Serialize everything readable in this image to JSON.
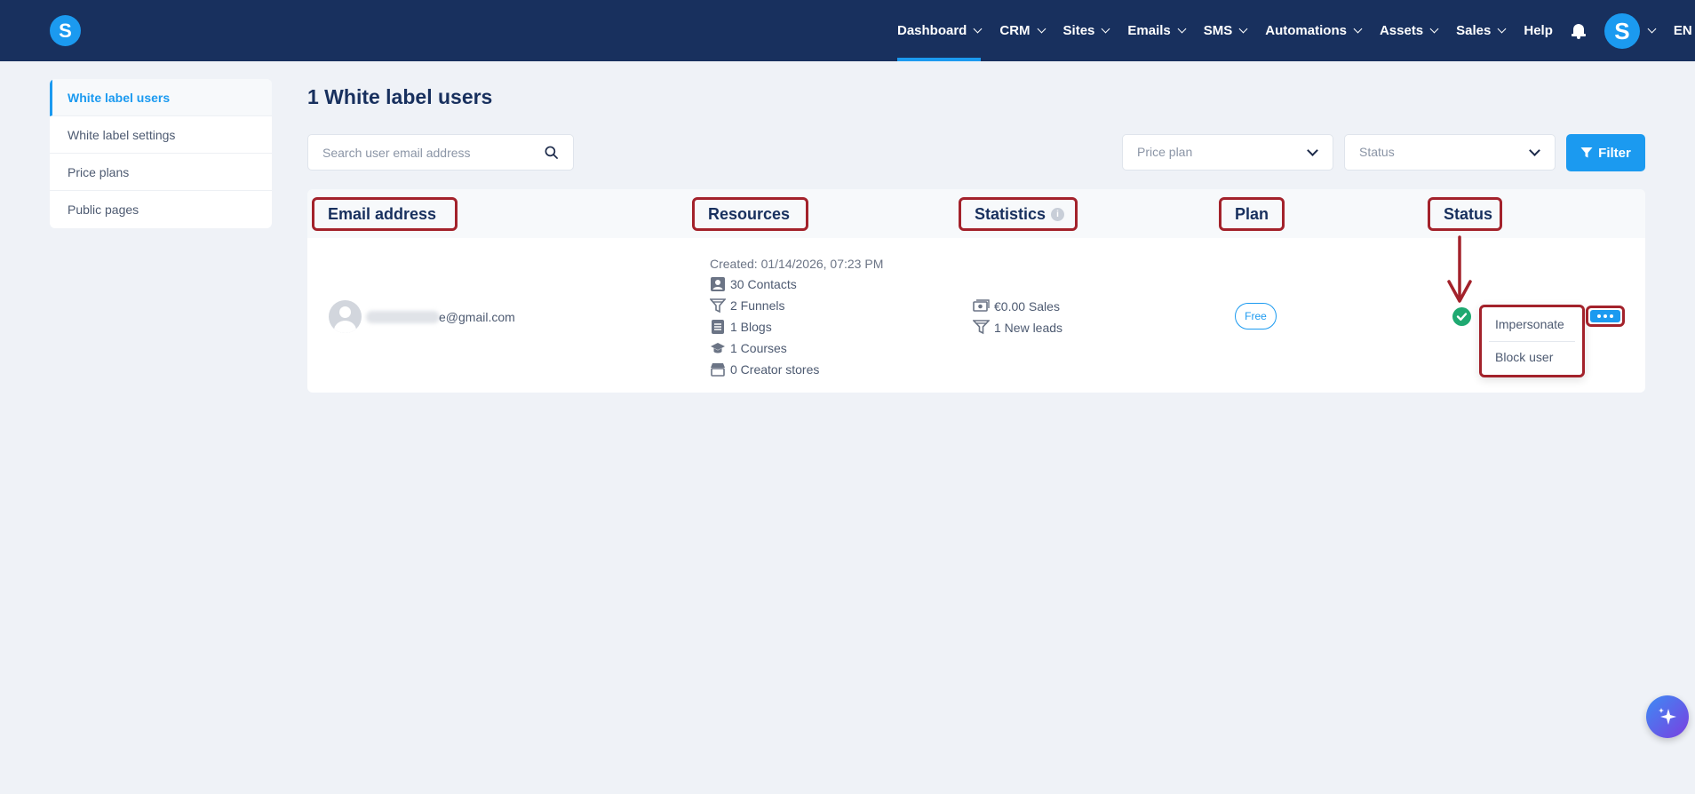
{
  "brand": {
    "logo_letter": "S"
  },
  "nav": {
    "items": [
      {
        "label": "Dashboard"
      },
      {
        "label": "CRM"
      },
      {
        "label": "Sites"
      },
      {
        "label": "Emails"
      },
      {
        "label": "SMS"
      },
      {
        "label": "Automations"
      },
      {
        "label": "Assets"
      },
      {
        "label": "Sales"
      },
      {
        "label": "Help"
      }
    ],
    "active": "Dashboard",
    "avatar_letter": "S",
    "language": "EN"
  },
  "sidebar": {
    "items": [
      {
        "label": "White label users",
        "active": true
      },
      {
        "label": "White label settings"
      },
      {
        "label": "Price plans"
      },
      {
        "label": "Public pages"
      }
    ]
  },
  "page": {
    "title": "1 White label users"
  },
  "filters": {
    "search_placeholder": "Search user email address",
    "price_plan_placeholder": "Price plan",
    "status_placeholder": "Status",
    "filter_label": "Filter"
  },
  "table": {
    "headers": {
      "email": "Email address",
      "resources": "Resources",
      "statistics": "Statistics",
      "plan": "Plan",
      "status": "Status"
    },
    "row": {
      "email": "e@gmail.com",
      "created": "Created: 01/14/2026, 07:23 PM",
      "resources": [
        {
          "icon": "contacts-icon",
          "label": "30 Contacts"
        },
        {
          "icon": "funnel-icon",
          "label": "2 Funnels"
        },
        {
          "icon": "blog-icon",
          "label": "1 Blogs"
        },
        {
          "icon": "course-icon",
          "label": "1 Courses"
        },
        {
          "icon": "store-icon",
          "label": "0 Creator stores"
        }
      ],
      "statistics": [
        {
          "icon": "money-icon",
          "label": "€0.00 Sales"
        },
        {
          "icon": "funnel-icon",
          "label": "1 New leads"
        }
      ],
      "plan": "Free",
      "status": "active"
    }
  },
  "row_menu": {
    "items": [
      {
        "label": "Impersonate"
      },
      {
        "label": "Block user"
      }
    ]
  },
  "colors": {
    "topbar": "#18305e",
    "accent": "#1b9af0",
    "annotation": "#a3222b",
    "success": "#1fa971"
  }
}
